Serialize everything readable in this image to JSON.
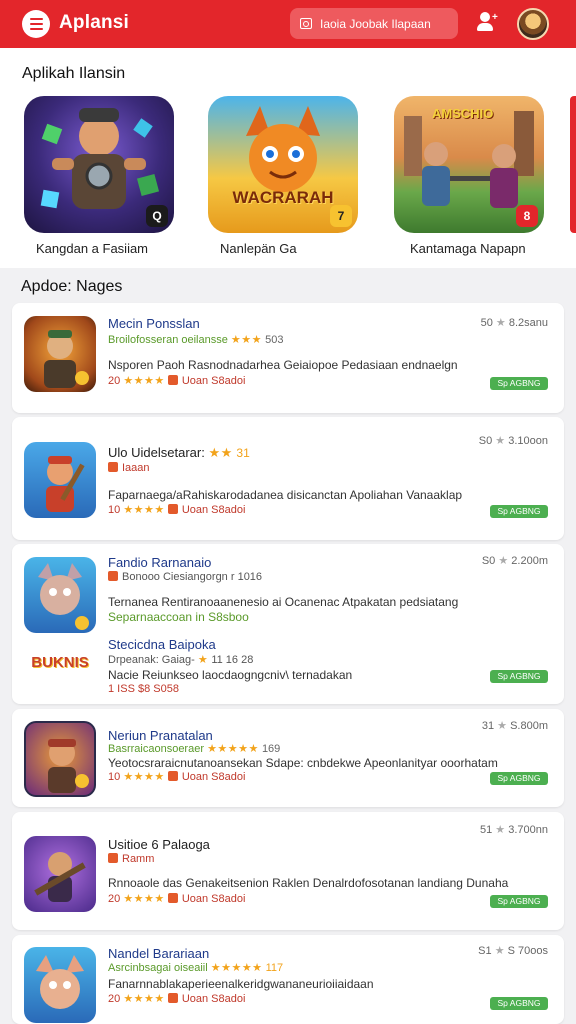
{
  "header": {
    "title": "Aplansi",
    "search_text": "Iaoia  Joobak  Ilapaan"
  },
  "colors": {
    "brand": "#e3262b",
    "rating": "#f2a31b",
    "install": "#4caf50",
    "link": "#1f3a8a"
  },
  "featured": {
    "title": "Aplikah Ilansin",
    "items": [
      {
        "label": "Kangdan a Fasiiam",
        "badge": "Q"
      },
      {
        "label": "Nanlepän Ga",
        "badge": "7",
        "art_text": "WACRARAH"
      },
      {
        "label": "Kantamaga Napapn",
        "badge": "8",
        "art_text": "AMSCHIO"
      }
    ]
  },
  "list_title": "Apdoe: Nages",
  "apps": [
    {
      "name": "Mecin Ponsslan",
      "sub": "Broilofosseran oeilansse",
      "stars_inline": "★★★",
      "count": "503",
      "rating": "50",
      "size": "8.2sanu",
      "desc": "Nsporen Paoh Rasnodnadarhea Geiaiopoe Pedasiaan endnaelgn",
      "meta_num": "20",
      "meta_stars": "★★★★",
      "meta_text": "Uoan S8adoi",
      "install": "Sp AGBNG"
    },
    {
      "name": "Ulo Uidelsetarar:",
      "sub": "Iaaan",
      "stars_inline": "★★",
      "count": "31",
      "rating": "S0",
      "size": "3.10oon",
      "desc": "Faparnaega/aRahiskarodadanea disicanctan Apoliahan Vanaaklap",
      "meta_num": "10",
      "meta_stars": "★★★★",
      "meta_text": "Uoan S8adoi",
      "install": "Sp AGBNG"
    },
    {
      "name": "Fandio Rarnanaio",
      "sub": "Bonooo Ciesiangorgn r 1016",
      "rating": "S0",
      "size": "2.200m",
      "desc": "Ternanea Rentiranoaanenesio ai Ocanenac Atpakatan pedsiatang",
      "desc2": "Separnaaccoan    in    S8sboo",
      "name2": "Stecicdna Baipoka",
      "sub2": "Drpeanak: Gaiag-",
      "stars2": "★",
      "count2": "11 16 28",
      "desc3": "Nacie Reiunkseo laocdaogngcniv\\ ternadakan",
      "meta3": "1 ISS $8 S058",
      "logo_text": "BUKNIS",
      "install": "Sp AGBNG"
    },
    {
      "name": "Neriun Pranatalan",
      "sub": "Basrraicaonsoeraer",
      "stars_inline": "★★★★★",
      "count": "169",
      "rating": "31",
      "size": "S.800m",
      "desc": "Yeotocsraraicnutanoansekan Sdape: cnbdekwe Apeonlanityar ooorhatam",
      "meta_num": "10",
      "meta_stars": "★★★★",
      "meta_text": "Uoan S8adoi",
      "install": "Sp AGBNG"
    },
    {
      "name": "Usitioe 6 Palaoga",
      "sub": "Ramm",
      "rating": "51",
      "size": "3.700nn",
      "desc": "Rnnoaole das Genakeitsenion Raklen Denalrdofosotanan landiang Dunaha",
      "meta_num": "20",
      "meta_stars": "★★★★",
      "meta_text": "Uoan S8adoi",
      "install": "Sp AGBNG"
    },
    {
      "name": "Nandel Barariaan",
      "sub": "Asrcinbsagai oiseaiil",
      "stars_inline": "★★★★★",
      "count": "117",
      "rating": "S1",
      "size": "S 70oos",
      "desc": "Fanarnnablakaperieenalkeridgwananeurioiiaidaan",
      "meta_num": "20",
      "meta_stars": "★★★★",
      "meta_text": "Uoan S8adoi",
      "install": "Sp AGBNG"
    }
  ]
}
